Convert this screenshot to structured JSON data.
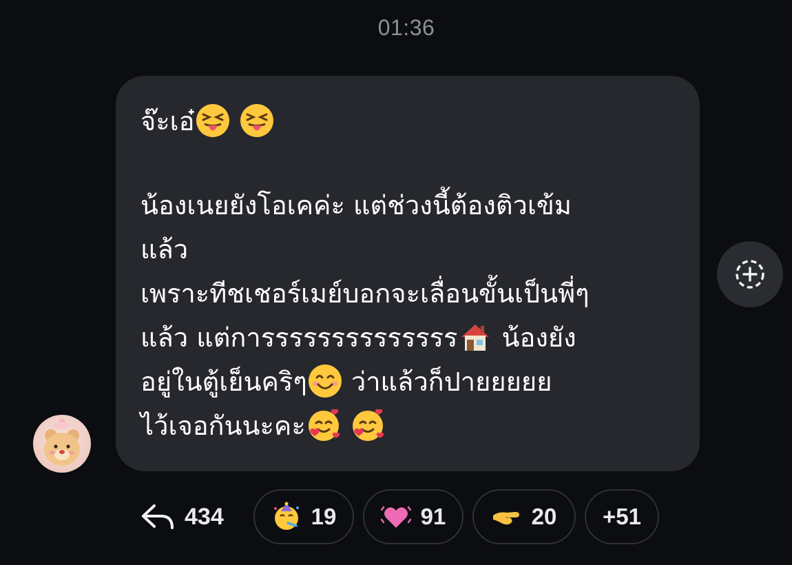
{
  "header": {
    "time": "01:36"
  },
  "message": {
    "line1_text": "จ๊ะเอ๋",
    "line1_emojis": [
      "squinting-tongue-emoji",
      "squinting-tongue-emoji"
    ],
    "line2": "น้องเนยยังโอเคค่ะ แต่ช่วงนี้ต้องติวเข้ม",
    "line3": "แล้ว",
    "line4": "เพราะทีชเชอร์เมย์บอกจะเลื่อนขั้นเป็นพี่ๆ",
    "line5_text": "แล้ว แต่การรรรรรรรรรรรรร",
    "line5_tail": "น้องยัง",
    "line6_text": "อยู่ในตู้เย็นคริๆ",
    "line6_tail": "ว่าแล้วก็ปายยยยย",
    "line7_text": "ไว้เจอกันนะคะ",
    "emojis": [
      "house-emoji",
      "smiling-face-emoji",
      "smiling-hearts-emoji"
    ]
  },
  "reactions": {
    "reply_count": "434",
    "items": [
      {
        "icon": "party-face-emoji",
        "count": "19"
      },
      {
        "icon": "vibrating-heart-emoji",
        "count": "91"
      },
      {
        "icon": "pinching-hand-emoji",
        "count": "20"
      }
    ],
    "more": "+51"
  },
  "colors": {
    "background": "#0c0d10",
    "bubble": "#26282d",
    "text": "#ffffff",
    "muted": "#8e9096"
  }
}
